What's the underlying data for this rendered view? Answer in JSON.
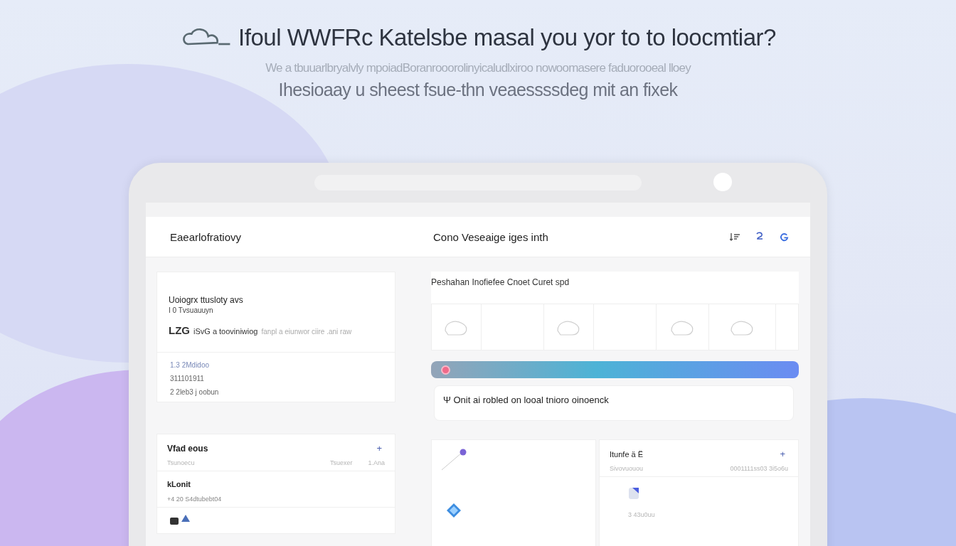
{
  "headline": "Ifoul WWFRc Katelsbe masal you yor to to loocmtiar?",
  "subline": "We a tbuuarlbryalvly mpoiadBoranrooorolinyicaludlxiroo nowoomasere faduorooeal lloey",
  "tagline": "Ihesioaay u sheest fsue-thn veaessssdeg mit an fixek",
  "app_header": {
    "title": "Eaearlofratiovy",
    "section": "Cono Veseaige iges inth"
  },
  "info_card": {
    "heading": "Uoiogrx ttusloty avs",
    "subheading": "I 0 Tvsuauuyn",
    "code": "LZG",
    "line": "iSvG a tooviniwiog",
    "line_muted": "fanpl a eiunwor ciire .ani raw",
    "rows": [
      {
        "text": "1.3 2Mdidoo",
        "accent": true
      },
      {
        "text": "311101911",
        "accent": false
      },
      {
        "text": "2 2leb3 j oobun",
        "accent": false
      }
    ]
  },
  "gallery": {
    "title": "Peshahan Inofiefee Cnoet Curet spd",
    "tiles": [
      {
        "sketch": true
      },
      {
        "sketch": false
      },
      {
        "sketch": true
      },
      {
        "sketch": false
      },
      {
        "sketch": true
      },
      {
        "sketch": true
      }
    ]
  },
  "notice": {
    "glyph": "Ψ",
    "text": "Onit ai robled on looal tnioro oinoenck"
  },
  "list_card": {
    "title": "Vfad eous",
    "add_glyph": "+",
    "meta": "Tsunoecu",
    "meta_right": "Tsuexer",
    "meta_far": "1.Ana",
    "items": [
      {
        "title": "kLonit",
        "sub": "+4 20 S4dtubebt04"
      }
    ]
  },
  "detail_card": {
    "title": "Itunfe ä Ë",
    "add_glyph": "+",
    "meta": "Sivovuouou",
    "meta_right": "0001111ss03 3i5o6u",
    "row_meta": "3 43u0uu"
  }
}
